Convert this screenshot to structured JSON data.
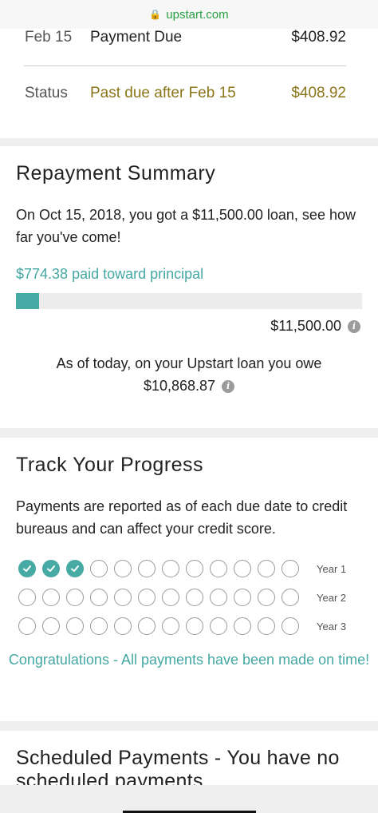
{
  "browser": {
    "url": "upstart.com"
  },
  "due": {
    "row1": {
      "date": "Feb 15",
      "label": "Payment Due",
      "amount": "$408.92"
    },
    "row2": {
      "date": "Status",
      "label": "Past due after Feb 15",
      "amount": "$408.92"
    }
  },
  "repayment": {
    "title": "Repayment Summary",
    "intro": "On Oct 15, 2018, you got a $11,500.00 loan, see how far you've come!",
    "principal_paid": "$774.38 paid toward principal",
    "progress_fraction": 0.0673,
    "loan_total": "$11,500.00",
    "owe_text": "As of today, on your Upstart loan you owe",
    "owe_amount": "$10,868.87"
  },
  "progress": {
    "title": "Track Your Progress",
    "description": "Payments are reported as of each due date to credit bureaus and can affect your credit score.",
    "years": [
      {
        "label": "Year 1",
        "completed": 3,
        "total": 12
      },
      {
        "label": "Year 2",
        "completed": 0,
        "total": 12
      },
      {
        "label": "Year 3",
        "completed": 0,
        "total": 12
      }
    ],
    "congrats": "Congratulations - All payments have been made on time!"
  },
  "scheduled": {
    "title": "Scheduled Payments - You have no scheduled payments"
  },
  "colors": {
    "accent": "#47aaa4",
    "warning": "#8a7519",
    "secure": "#2aa043"
  }
}
